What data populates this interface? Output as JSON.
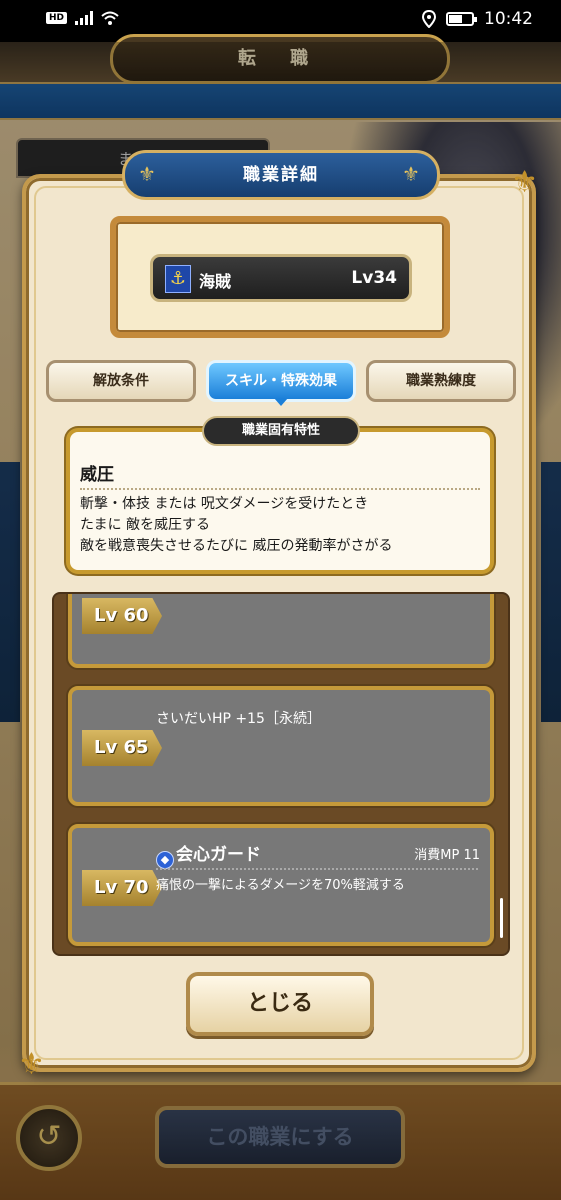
{
  "status_bar": {
    "network": "HD",
    "time": "10:42"
  },
  "background": {
    "banner_title": "転 職",
    "tab_text": "ま",
    "set_job_button": "この職業にする",
    "back_icon": "back-arrow-icon"
  },
  "modal": {
    "title": "職業詳細",
    "job": {
      "name": "海賊",
      "level": "Lv34",
      "icon": "anchor-icon"
    },
    "tabs": [
      {
        "label": "解放条件",
        "active": false
      },
      {
        "label": "スキル・特殊効果",
        "active": true
      },
      {
        "label": "職業熟練度",
        "active": false
      }
    ],
    "trait": {
      "section_label": "職業固有特性",
      "name": "威圧",
      "desc_lines": [
        "斬撃・体技 または 呪文ダメージを受けたとき",
        "たまに 敵を威圧する",
        "敵を戦意喪失させるたびに 威圧の発動率がさがる"
      ]
    },
    "skills": [
      {
        "level": "Lv 60",
        "text": ""
      },
      {
        "level": "Lv 65",
        "text": "さいだいHP +15［永続］"
      },
      {
        "level": "Lv 70",
        "title": "会心ガード",
        "mp": "消費MP 11",
        "desc": "痛恨の一撃によるダメージを70%軽減する",
        "icon": "shield-skill-icon"
      }
    ],
    "close_button": "とじる"
  }
}
